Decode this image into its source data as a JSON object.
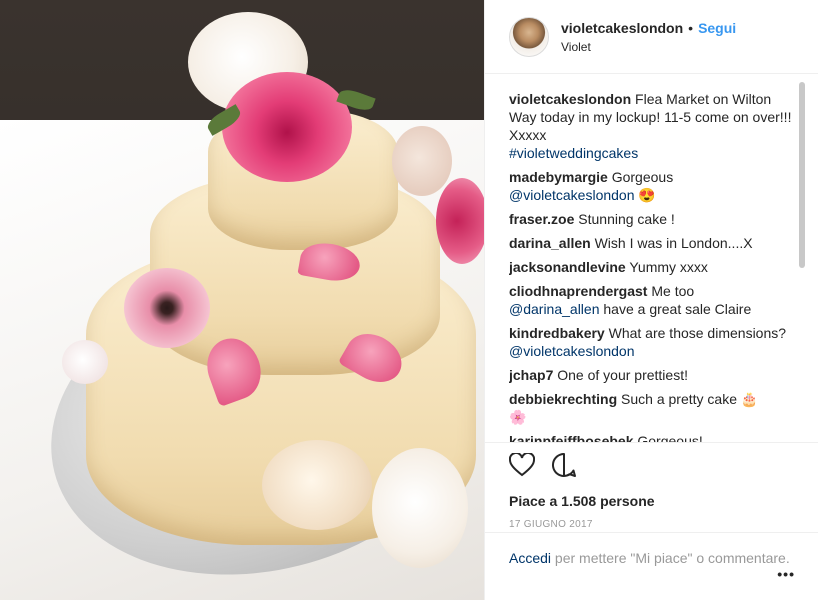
{
  "header": {
    "username": "violetcakeslondon",
    "separator": "•",
    "follow_label": "Segui",
    "location": "Violet"
  },
  "comments": [
    {
      "user": "violetcakeslondon",
      "text": "Flea Market on Wilton Way today in my lockup! 11-5 come on over!!! Xxxxx",
      "tag": "#violetweddingcakes"
    },
    {
      "user": "madebymargie",
      "text": "Gorgeous",
      "tag": "@violetcakeslondon",
      "emoji": "😍"
    },
    {
      "user": "fraser.zoe",
      "text": "Stunning cake !"
    },
    {
      "user": "darina_allen",
      "text": "Wish I was in London....X"
    },
    {
      "user": "jacksonandlevine",
      "text": "Yummy xxxx"
    },
    {
      "user": "cliodhnaprendergast",
      "text": "Me too",
      "tag": "@darina_allen",
      "text2": "have a great sale Claire"
    },
    {
      "user": "kindredbakery",
      "text": "What are those dimensions?",
      "tag": "@violetcakeslondon"
    },
    {
      "user": "jchap7",
      "text": "One of your prettiest!"
    },
    {
      "user": "debbiekrechting",
      "text": "Such a pretty cake",
      "emoji": "🎂",
      "emoji2": "🌸"
    },
    {
      "user": "karinpfeiffbosebek",
      "text": "Gorgeous!"
    }
  ],
  "actions": {
    "heart_icon": "heart-outline",
    "comment_icon": "speech-bubble",
    "likes_text": "Piace a 1.508 persone",
    "date": "17 GIUGNO 2017"
  },
  "login": {
    "link": "Accedi",
    "rest": "per mettere \"Mi piace\" o commentare.",
    "more": "•••"
  },
  "colors": {
    "accent": "#3897f0",
    "link": "#003569",
    "muted": "#999999"
  }
}
